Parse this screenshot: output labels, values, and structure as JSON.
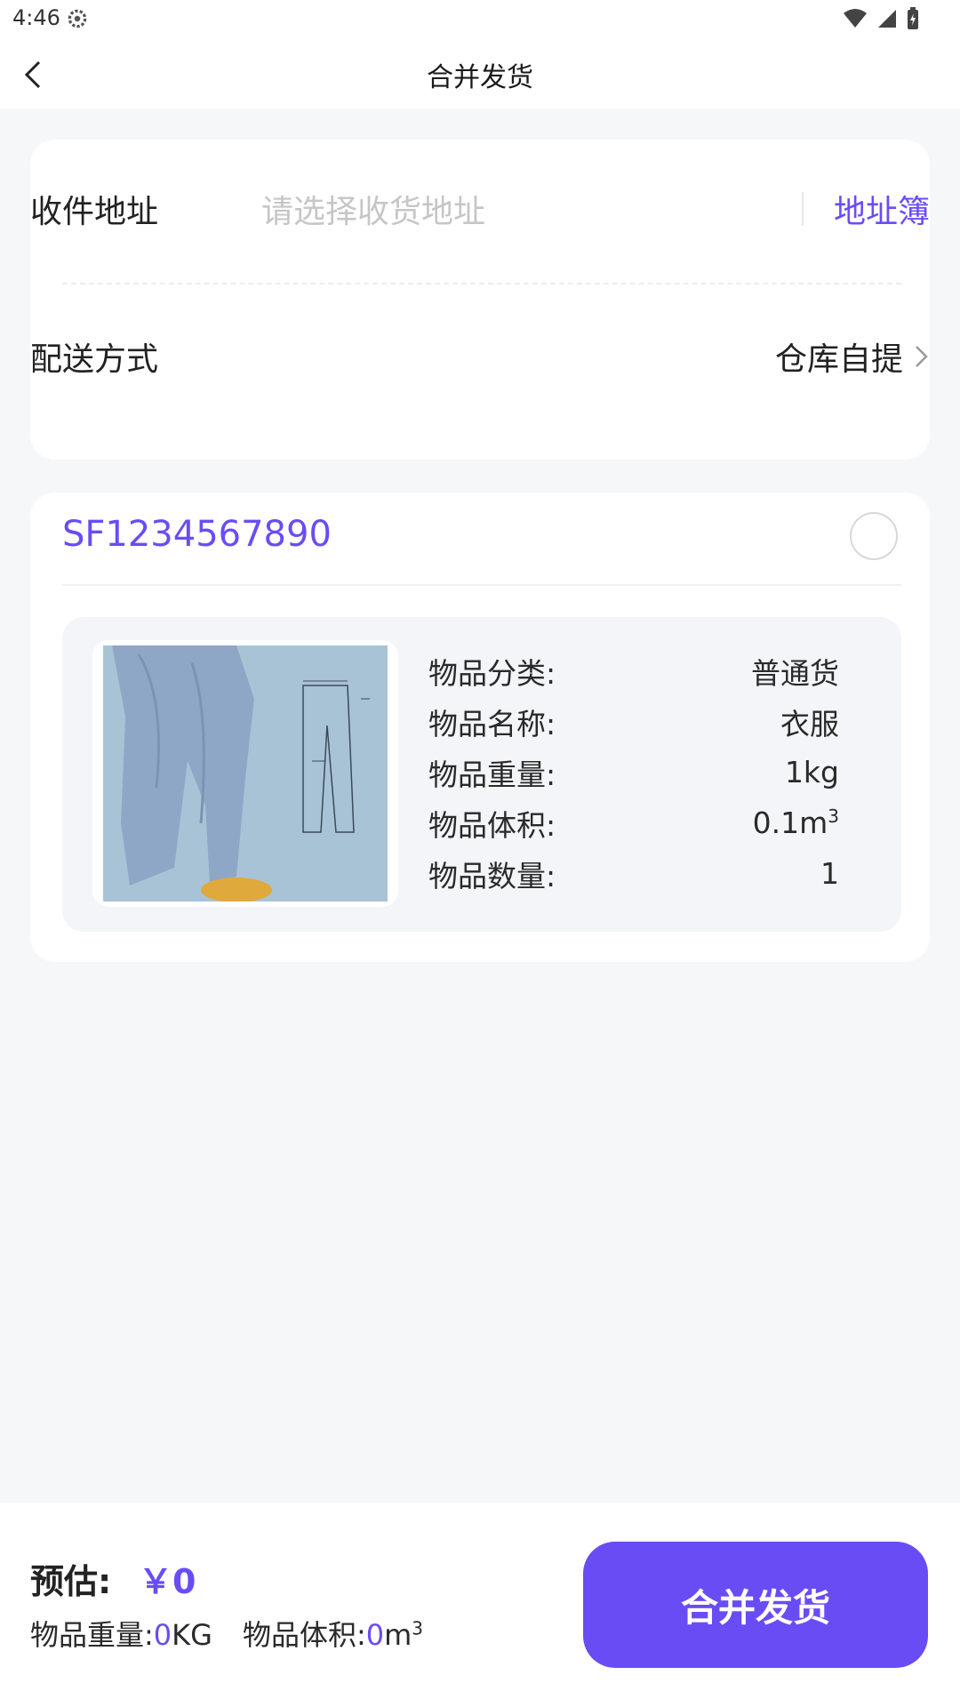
{
  "status_bar": {
    "time": "4:46"
  },
  "header": {
    "title": "合并发货"
  },
  "address": {
    "label": "收件地址",
    "placeholder": "请选择收货地址",
    "book_label": "地址簿"
  },
  "delivery": {
    "label": "配送方式",
    "value": "仓库自提"
  },
  "package": {
    "tracking_no": "SF1234567890",
    "details": [
      {
        "label": "物品分类:",
        "value": "普通货"
      },
      {
        "label": "物品名称:",
        "value": "衣服"
      },
      {
        "label": "物品重量:",
        "value": "1kg"
      },
      {
        "label": "物品体积:",
        "value": "0.1m",
        "sup": "3"
      },
      {
        "label": "物品数量:",
        "value": "1"
      }
    ]
  },
  "footer": {
    "estimate_label": "预估:",
    "estimate_value": "￥0",
    "weight_label": "物品重量:",
    "weight_value": "0",
    "weight_unit": "KG",
    "volume_label": "物品体积:",
    "volume_value": "0",
    "volume_unit": "m",
    "volume_sup": "3",
    "merge_button": "合并发货"
  },
  "colors": {
    "accent": "#6a4cf5",
    "background": "#f6f7f9"
  },
  "icons": {
    "back": "chevron-left-icon",
    "settings": "gear-icon",
    "arrow": "chevron-right-icon"
  }
}
